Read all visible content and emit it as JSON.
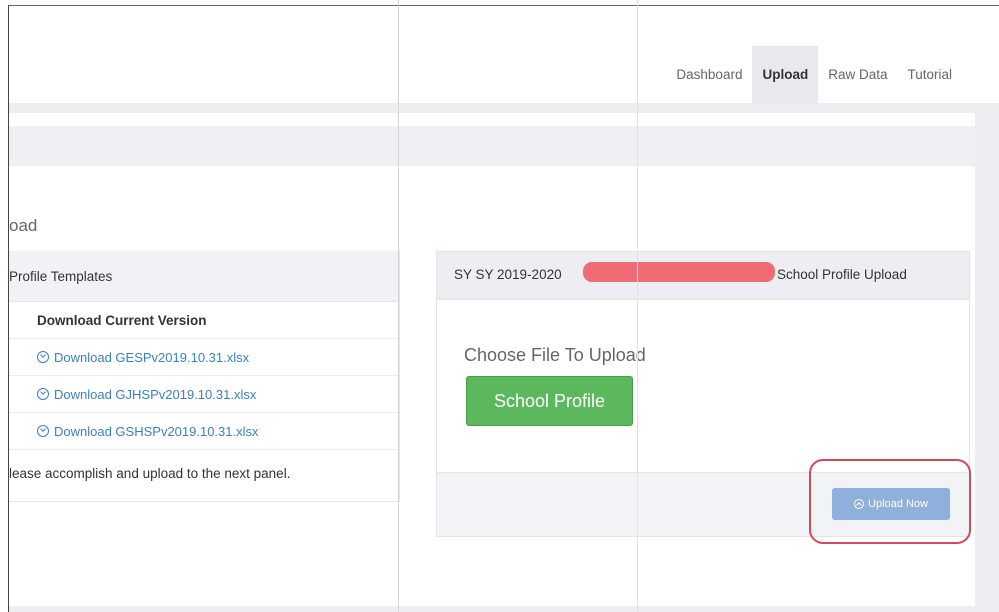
{
  "nav": {
    "items": [
      {
        "label": "Dashboard",
        "active": false
      },
      {
        "label": "Upload",
        "active": true
      },
      {
        "label": "Raw Data",
        "active": false
      },
      {
        "label": "Tutorial",
        "active": false
      }
    ]
  },
  "section_title": "oad",
  "left_panel": {
    "header": "Profile Templates",
    "table_header": "Download Current Version",
    "downloads": [
      "Download GESPv2019.10.31.xlsx",
      "Download GJHSPv2019.10.31.xlsx",
      "Download GSHSPv2019.10.31.xlsx"
    ],
    "note": "lease accomplish and upload to the next panel."
  },
  "right_panel": {
    "header_prefix": "SY SY 2019-2020",
    "header_suffix": "School Profile Upload",
    "choose_label": "Choose File To Upload",
    "file_button_label": "School Profile",
    "upload_button_label": "Upload Now"
  },
  "colors": {
    "accent_link": "#3a7fc4",
    "file_button": "#5cb85c",
    "upload_button": "#8fb0da",
    "redaction": "#ef6a72",
    "annotation": "#d14a58"
  }
}
